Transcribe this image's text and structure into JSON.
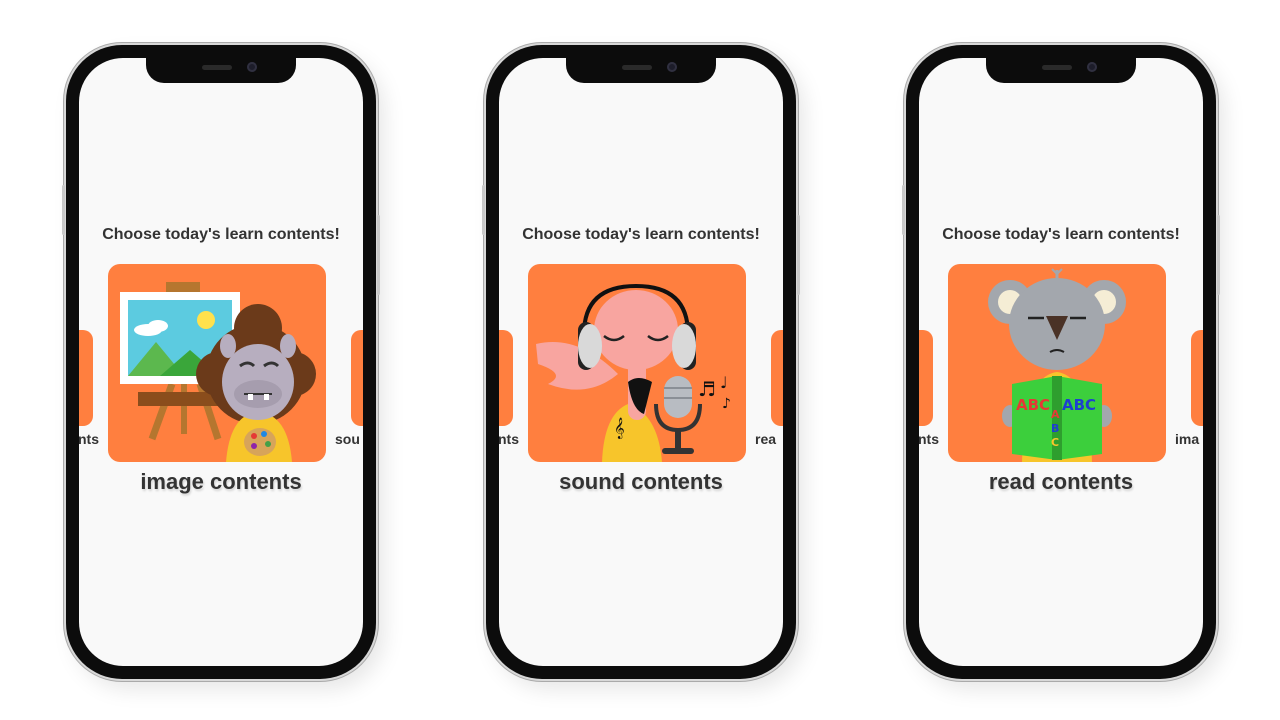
{
  "phones": [
    {
      "heading": "Choose today's learn contents!",
      "title": "image contents",
      "left_label": "nts",
      "right_label": "sou",
      "illustration": "hippo-painter"
    },
    {
      "heading": "Choose today's learn contents!",
      "title": "sound contents",
      "left_label": "nts",
      "right_label": "rea",
      "illustration": "flamingo-singer"
    },
    {
      "heading": "Choose today's learn contents!",
      "title": "read contents",
      "left_label": "nts",
      "right_label": "ima",
      "illustration": "koala-reader",
      "book_letters": [
        "ABC",
        "ABC",
        "A",
        "B",
        "C"
      ]
    }
  ],
  "colors": {
    "card": "#ff7f3f",
    "phone_frame": "#0c0c0c",
    "screen": "#f9f9f9",
    "text": "#333333"
  }
}
